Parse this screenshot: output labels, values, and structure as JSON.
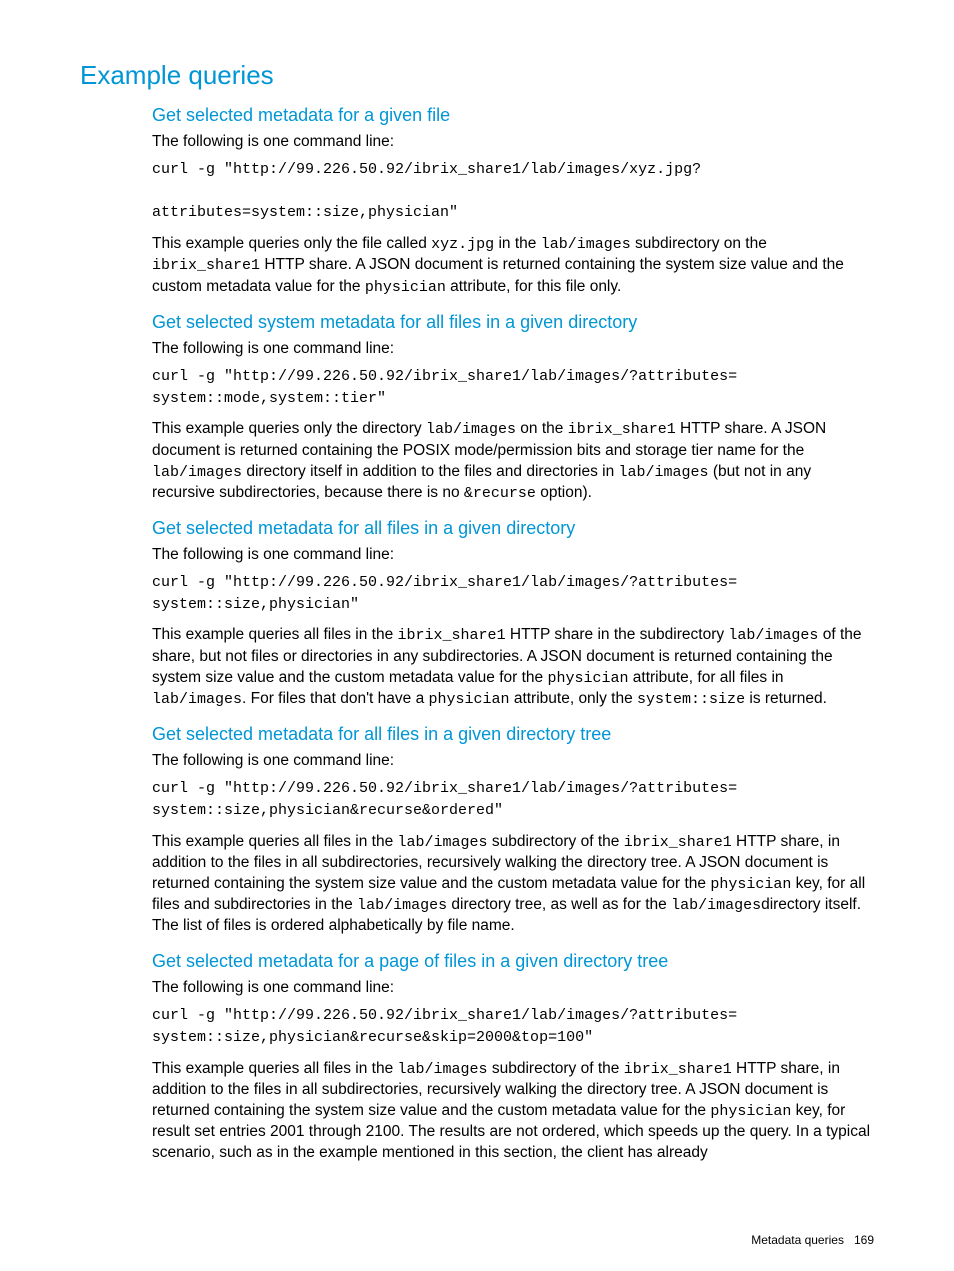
{
  "page_title": "Example queries",
  "sections": [
    {
      "heading": "Get selected metadata for a given file",
      "lead": "The following is one command line:",
      "code": "curl -g \"http://99.226.50.92/ibrix_share1/lab/images/xyz.jpg?\n\nattributes=system::size,physician\"",
      "desc_parts": [
        "This example queries only the file called ",
        "xyz.jpg",
        " in the ",
        "lab/images",
        " subdirectory on the ",
        "ibrix_share1",
        " HTTP share. A JSON document is returned containing the system size value and the custom metadata value for the ",
        "physician",
        " attribute, for this file only."
      ]
    },
    {
      "heading": "Get selected system metadata for all files in a given directory",
      "lead": "The following is one command line:",
      "code": "curl -g \"http://99.226.50.92/ibrix_share1/lab/images/?attributes=\nsystem::mode,system::tier\"",
      "desc_parts": [
        "This example queries only the directory ",
        "lab/images",
        " on the ",
        "ibrix_share1",
        " HTTP share. A JSON document is returned containing the POSIX mode/permission bits and storage tier name for the ",
        "lab/images",
        " directory itself in addition to the files and directories in ",
        "lab/images",
        " (but not in any recursive subdirectories, because there is no ",
        "&recurse",
        " option)."
      ]
    },
    {
      "heading": "Get selected metadata for all files in a given directory",
      "lead": "The following is one command line:",
      "code": "curl -g \"http://99.226.50.92/ibrix_share1/lab/images/?attributes=\nsystem::size,physician\"",
      "desc_parts": [
        "This example queries all files in the ",
        "ibrix_share1",
        " HTTP share in the subdirectory ",
        "lab/images",
        " of the share, but not files or directories in any subdirectories. A JSON document is returned containing the system size value and the custom metadata value for the ",
        "physician",
        " attribute, for all files in ",
        "lab/images",
        ". For files that don't have a ",
        "physician",
        " attribute, only the ",
        "system::size",
        " is returned."
      ]
    },
    {
      "heading": "Get selected metadata for all files in a given directory tree",
      "lead": "The following is one command line:",
      "code": "curl -g \"http://99.226.50.92/ibrix_share1/lab/images/?attributes=\nsystem::size,physician&recurse&ordered\"",
      "desc_parts": [
        "This example queries all files in the ",
        "lab/images",
        " subdirectory of the ",
        "ibrix_share1",
        " HTTP share, in addition to the files in all subdirectories, recursively walking the directory tree. A JSON document is returned containing the system size value and the custom metadata value for the ",
        "physician",
        " key, for all files and subdirectories in the ",
        "lab/images",
        " directory tree, as well as for the ",
        "lab/images",
        "directory itself. The list of files is ordered alphabetically by file name."
      ]
    },
    {
      "heading": "Get selected metadata for a page of files in a given directory tree",
      "lead": "The following is one command line:",
      "code": "curl -g \"http://99.226.50.92/ibrix_share1/lab/images/?attributes=\nsystem::size,physician&recurse&skip=2000&top=100\"",
      "desc_parts": [
        "This example queries all files in the ",
        "lab/images",
        " subdirectory of the ",
        "ibrix_share1",
        " HTTP share, in addition to the files in all subdirectories, recursively walking the directory tree. A JSON document is returned containing the system size value and the custom metadata value for the ",
        "physician",
        " key, for result set entries 2001 through 2100. The results are not ordered, which speeds up the query. In a typical scenario, such as in the example mentioned in this section, the client has already"
      ]
    }
  ],
  "footer": {
    "section": "Metadata queries",
    "pagenum": "169"
  }
}
